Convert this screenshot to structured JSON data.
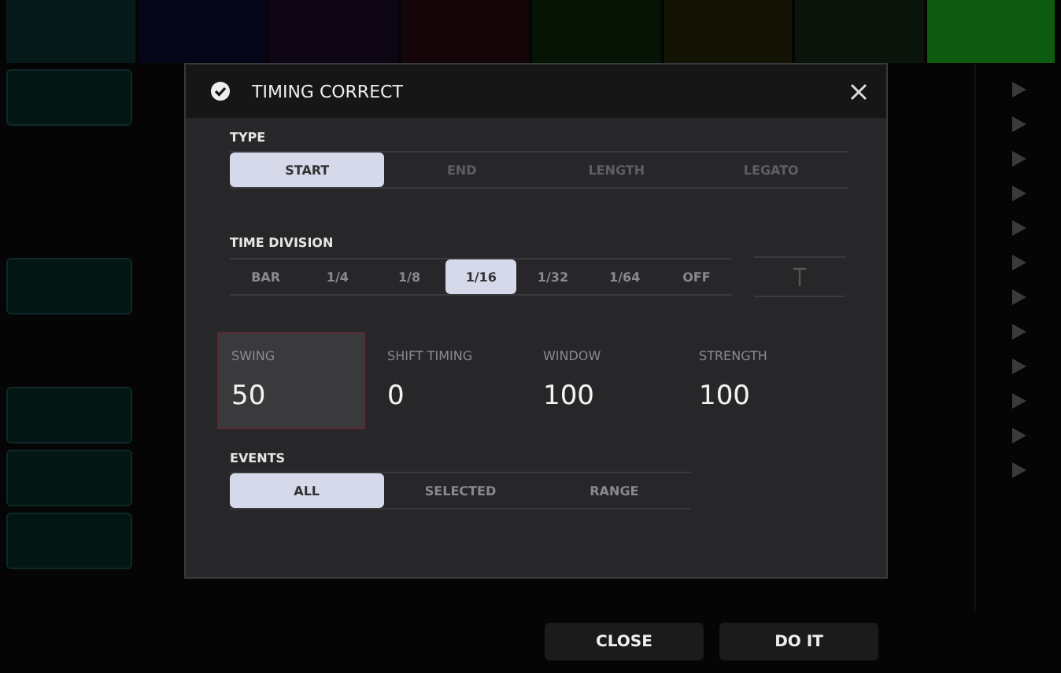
{
  "dialog": {
    "title": "TIMING CORRECT"
  },
  "type": {
    "label": "TYPE",
    "options": [
      {
        "label": "START",
        "selected": true,
        "disabled": false
      },
      {
        "label": "END",
        "selected": false,
        "disabled": true
      },
      {
        "label": "LENGTH",
        "selected": false,
        "disabled": true
      },
      {
        "label": "LEGATO",
        "selected": false,
        "disabled": true
      }
    ]
  },
  "time_division": {
    "label": "TIME DIVISION",
    "options": [
      {
        "label": "BAR",
        "selected": false
      },
      {
        "label": "1/4",
        "selected": false
      },
      {
        "label": "1/8",
        "selected": false
      },
      {
        "label": "1/16",
        "selected": true
      },
      {
        "label": "1/32",
        "selected": false
      },
      {
        "label": "1/64",
        "selected": false
      },
      {
        "label": "OFF",
        "selected": false
      }
    ]
  },
  "params": [
    {
      "label": "SWING",
      "value": "50",
      "selected": true
    },
    {
      "label": "SHIFT TIMING",
      "value": "0",
      "selected": false
    },
    {
      "label": "WINDOW",
      "value": "100",
      "selected": false
    },
    {
      "label": "STRENGTH",
      "value": "100",
      "selected": false
    }
  ],
  "events": {
    "label": "EVENTS",
    "options": [
      {
        "label": "ALL",
        "selected": true
      },
      {
        "label": "SELECTED",
        "selected": false
      },
      {
        "label": "RANGE",
        "selected": false
      }
    ]
  },
  "buttons": [
    "CLOSE",
    "DO IT"
  ]
}
